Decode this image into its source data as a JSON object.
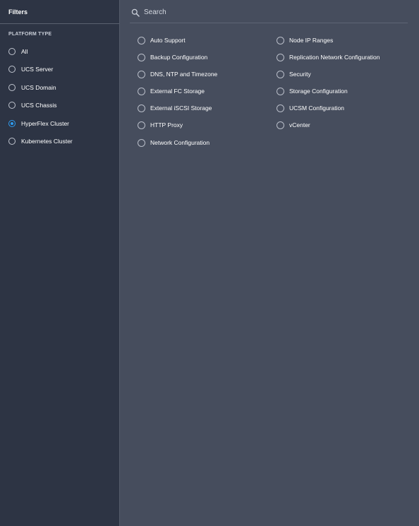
{
  "sidebar": {
    "title": "Filters",
    "section_label": "PLATFORM TYPE",
    "items": [
      {
        "label": "All",
        "selected": false
      },
      {
        "label": "UCS Server",
        "selected": false
      },
      {
        "label": "UCS Domain",
        "selected": false
      },
      {
        "label": "UCS Chassis",
        "selected": false
      },
      {
        "label": "HyperFlex Cluster",
        "selected": true
      },
      {
        "label": "Kubernetes Cluster",
        "selected": false
      }
    ]
  },
  "search": {
    "placeholder": "Search",
    "value": "",
    "icon": "search-icon"
  },
  "options": {
    "left_column": [
      "Auto Support",
      "Backup Configuration",
      "DNS, NTP and Timezone",
      "External FC Storage",
      "External iSCSI Storage",
      "HTTP Proxy",
      "Network Configuration"
    ],
    "right_column": [
      "Node IP Ranges",
      "Replication Network Configuration",
      "Security",
      "Storage Configuration",
      "UCSM Configuration",
      "vCenter"
    ]
  },
  "colors": {
    "sidebar_bg": "#2d3444",
    "main_bg": "#464d5d",
    "accent": "#2f9cf0"
  }
}
